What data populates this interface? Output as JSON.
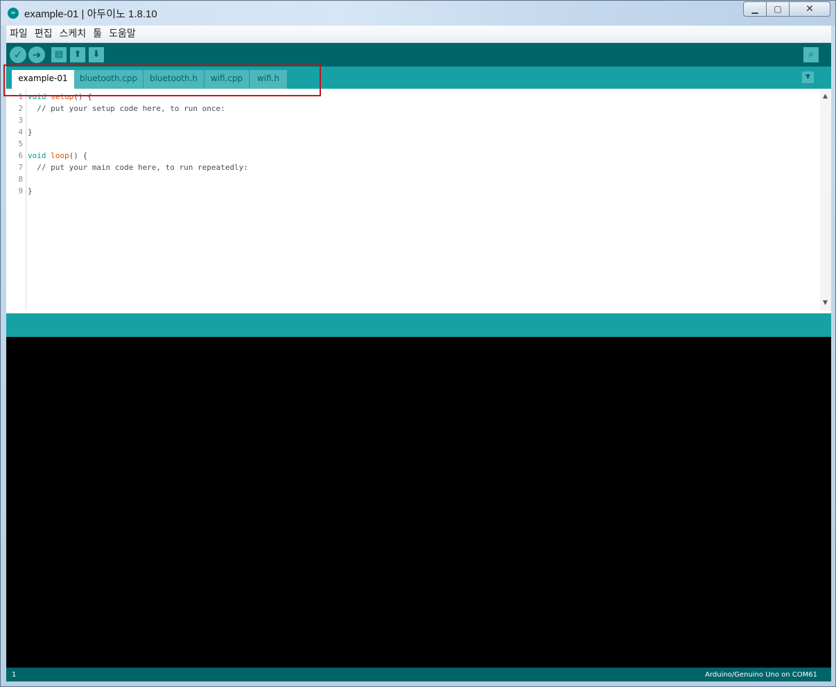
{
  "window": {
    "title": "example-01 | 아두이노 1.8.10",
    "app_icon": "arduino-logo-icon",
    "controls": {
      "minimize": "▁",
      "maximize": "▢",
      "close": "✕"
    }
  },
  "menu": {
    "items": [
      "파일",
      "편집",
      "스케치",
      "툴",
      "도움말"
    ]
  },
  "toolbar": {
    "verify_icon": "✓",
    "upload_icon": "➜",
    "new_icon": "▤",
    "open_icon": "⬆",
    "save_icon": "⬇",
    "serial_monitor_icon": "⌕"
  },
  "tabs": {
    "items": [
      {
        "label": "example-01",
        "active": true
      },
      {
        "label": "bluetooth.cpp",
        "active": false
      },
      {
        "label": "bluetooth.h",
        "active": false
      },
      {
        "label": "wifi.cpp",
        "active": false
      },
      {
        "label": "wifi.h",
        "active": false
      }
    ],
    "menu_icon": "▼"
  },
  "editor": {
    "line_numbers": [
      "1",
      "2",
      "3",
      "4",
      "5",
      "6",
      "7",
      "8",
      "9"
    ],
    "lines": [
      "void setup() {",
      "  // put your setup code here, to run once:",
      "",
      "}",
      "",
      "void loop() {",
      "  // put your main code here, to run repeatedly:",
      "",
      "}"
    ]
  },
  "status": {
    "line": "1",
    "board": "Arduino/Genuino Uno on COM61"
  },
  "colors": {
    "toolbar": "#006468",
    "tabbar": "#17a1a5",
    "button": "#4db7bb",
    "highlight": "#c0141c"
  }
}
